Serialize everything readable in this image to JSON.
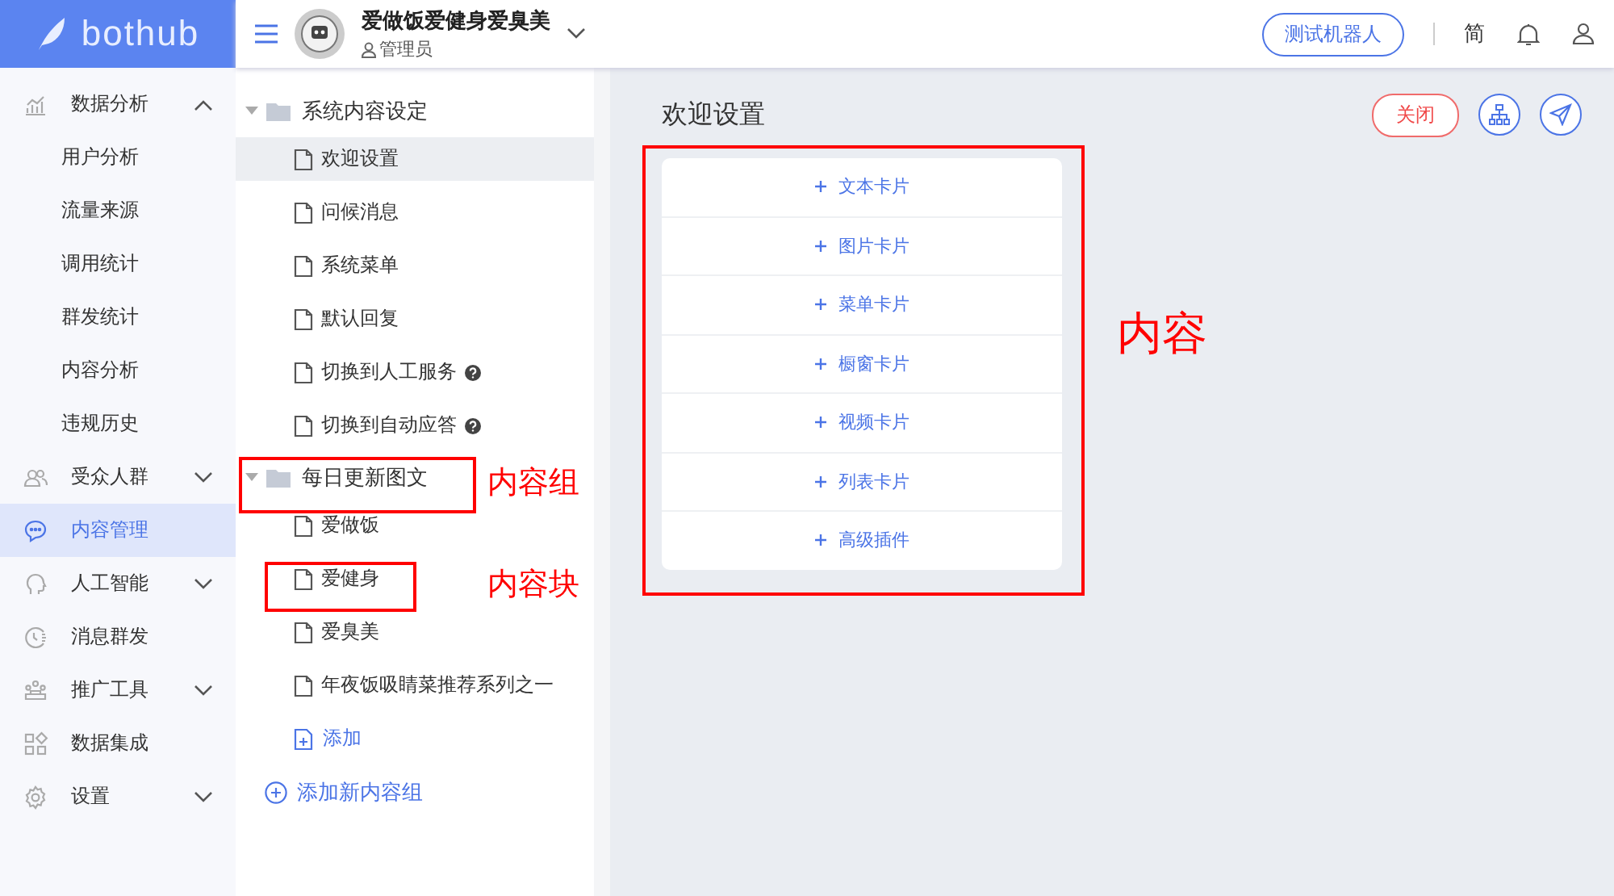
{
  "logo": {
    "text": "bothub"
  },
  "header": {
    "account_name": "爱做饭爱健身爱臭美",
    "role": "管理员",
    "test_button": "测试机器人",
    "language": "简"
  },
  "sidebar": {
    "items": [
      {
        "label": "数据分析",
        "kind": "group",
        "expanded": true,
        "selected": false,
        "children": [
          {
            "label": "用户分析"
          },
          {
            "label": "流量来源"
          },
          {
            "label": "调用统计"
          },
          {
            "label": "群发统计"
          },
          {
            "label": "内容分析"
          },
          {
            "label": "违规历史"
          }
        ]
      },
      {
        "label": "受众人群",
        "kind": "group",
        "expanded": false,
        "selected": false
      },
      {
        "label": "内容管理",
        "kind": "link",
        "selected": true
      },
      {
        "label": "人工智能",
        "kind": "group",
        "expanded": false,
        "selected": false
      },
      {
        "label": "消息群发",
        "kind": "link",
        "selected": false
      },
      {
        "label": "推广工具",
        "kind": "group",
        "expanded": false,
        "selected": false
      },
      {
        "label": "数据集成",
        "kind": "link",
        "selected": false
      },
      {
        "label": "设置",
        "kind": "group",
        "expanded": false,
        "selected": false
      }
    ]
  },
  "tree": {
    "groups": [
      {
        "title": "系统内容设定",
        "expanded": true,
        "items": [
          {
            "label": "欢迎设置",
            "selected": true,
            "help": false
          },
          {
            "label": "问候消息",
            "selected": false,
            "help": false
          },
          {
            "label": "系统菜单",
            "selected": false,
            "help": false
          },
          {
            "label": "默认回复",
            "selected": false,
            "help": false
          },
          {
            "label": "切换到人工服务",
            "selected": false,
            "help": true
          },
          {
            "label": "切换到自动应答",
            "selected": false,
            "help": true
          }
        ]
      },
      {
        "title": "每日更新图文",
        "expanded": true,
        "items": [
          {
            "label": "爱做饭",
            "selected": false,
            "help": false
          },
          {
            "label": "爱健身",
            "selected": false,
            "help": false
          },
          {
            "label": "爱臭美",
            "selected": false,
            "help": false
          },
          {
            "label": "年夜饭吸睛菜推荐系列之一",
            "selected": false,
            "help": false
          }
        ],
        "add_label": "添加"
      }
    ],
    "add_group": "添加新内容组"
  },
  "main": {
    "title": "欢迎设置",
    "close_button": "关闭",
    "cards": [
      {
        "label": "文本卡片"
      },
      {
        "label": "图片卡片"
      },
      {
        "label": "菜单卡片"
      },
      {
        "label": "橱窗卡片"
      },
      {
        "label": "视频卡片"
      },
      {
        "label": "列表卡片"
      },
      {
        "label": "高级插件"
      }
    ]
  },
  "annotations": [
    {
      "label": "内容组"
    },
    {
      "label": "内容块"
    },
    {
      "label": "内容"
    }
  ]
}
